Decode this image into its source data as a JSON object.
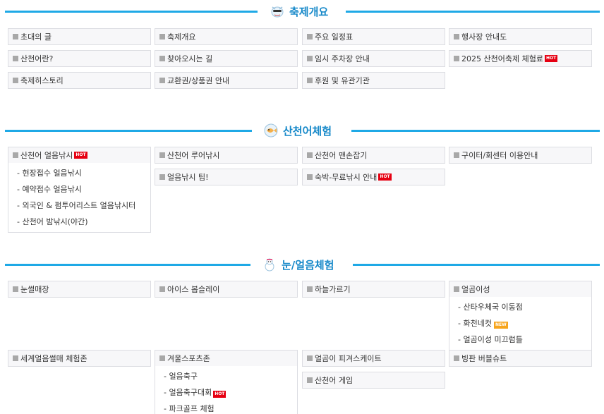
{
  "colors": {
    "accent": "#1fa9e6",
    "title": "#1789c9",
    "hot": "#e60012",
    "new": "#f7a51d"
  },
  "badges": {
    "hot": "HOT",
    "new": "NEW"
  },
  "sections": [
    {
      "title": "축제개요",
      "icon": "mascot-icon",
      "items": [
        {
          "label": "초대의 글"
        },
        {
          "label": "축제개요"
        },
        {
          "label": "주요 일정표"
        },
        {
          "label": "행사장 안내도"
        },
        {
          "label": "산천어란?"
        },
        {
          "label": "찾아오시는 길"
        },
        {
          "label": "임시 주차장 안내"
        },
        {
          "label": "2025 산천어축제 체험료",
          "badge": "hot"
        },
        {
          "label": "축제히스토리"
        },
        {
          "label": "교환권/상품권 안내"
        },
        {
          "label": "후원 및 유관기관"
        }
      ]
    },
    {
      "title": "산천어체험",
      "icon": "fish-icon",
      "items": [
        {
          "label": "산천어 얼음낚시",
          "badge": "hot",
          "sub": [
            {
              "label": "- 현장접수 얼음낚시"
            },
            {
              "label": "- 예약접수 얼음낚시"
            },
            {
              "label": "- 외국인 & 펌투어리스트 얼음낚시터"
            },
            {
              "label": "- 산천어 밤낚시(야간)"
            }
          ]
        },
        {
          "label": "산천어 루어낚시"
        },
        {
          "label": "산천어 맨손잡기"
        },
        {
          "label": "구이터/회센터 이용안내"
        },
        {
          "label": "얼음낚시 팁!"
        },
        {
          "label": "숙박-무료낚시 안내",
          "badge": "hot"
        }
      ]
    },
    {
      "title": "눈/얼음체험",
      "icon": "snowman-icon",
      "items": [
        {
          "label": "눈썰매장"
        },
        {
          "label": "아이스 봅슬레이"
        },
        {
          "label": "하늘가르기"
        },
        {
          "label": "얼곰이성",
          "sub": [
            {
              "label": "- 산타우체국 이동점"
            },
            {
              "label": "- 화천네컷",
              "badge": "new"
            },
            {
              "label": "- 얼곰이성 미끄럼틀"
            }
          ]
        },
        {
          "label": "세계얼음썰매 체험존"
        },
        {
          "label": "겨울스포츠존",
          "sub": [
            {
              "label": "- 얼음축구"
            },
            {
              "label": "- 얼음축구대회",
              "badge": "hot"
            },
            {
              "label": "- 파크골프 체험"
            }
          ]
        },
        {
          "label": "얼곰이 피겨스케이트"
        },
        {
          "label": "빙판 버블슈트"
        },
        {
          "label": "산천어 게임"
        }
      ]
    }
  ]
}
